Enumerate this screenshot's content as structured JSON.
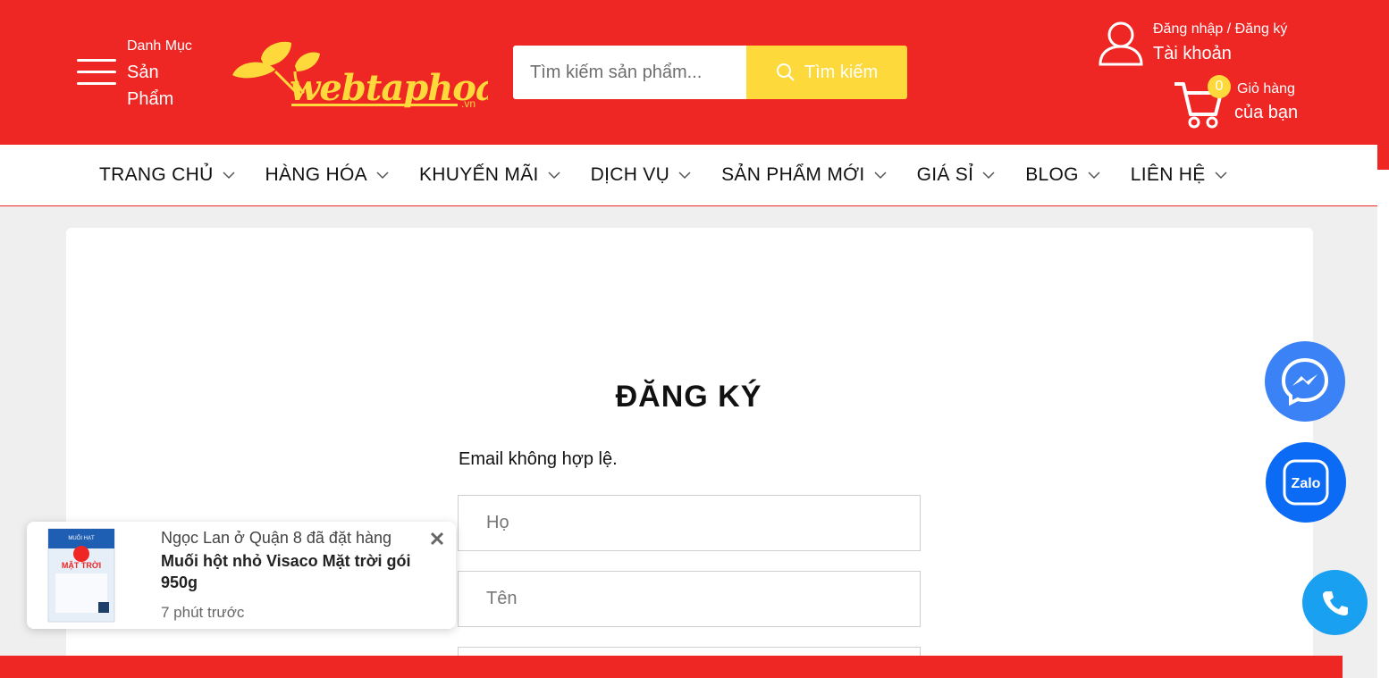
{
  "header": {
    "category_small": "Danh Mục",
    "category_big": "Sản Phẩm",
    "search_placeholder": "Tìm kiếm sản phẩm...",
    "search_button": "Tìm kiếm",
    "account_line1": "Đăng nhập / Đăng ký",
    "account_line2": "Tài khoản",
    "cart_count": "0",
    "cart_line1": "Giỏ hàng",
    "cart_line2": "của bạn",
    "logo_text": "webtaphoa",
    "logo_suffix": ".vn"
  },
  "nav": {
    "items": [
      {
        "label": "TRANG CHỦ"
      },
      {
        "label": "HÀNG HÓA"
      },
      {
        "label": "KHUYẾN MÃI"
      },
      {
        "label": "DỊCH VỤ"
      },
      {
        "label": "SẢN PHẨM MỚI"
      },
      {
        "label": "GIÁ SỈ"
      },
      {
        "label": "BLOG"
      },
      {
        "label": "LIÊN HỆ"
      }
    ]
  },
  "form": {
    "title": "ĐĂNG KÝ",
    "error": "Email không hợp lệ.",
    "last_name_placeholder": "Họ",
    "first_name_placeholder": "Tên"
  },
  "toast": {
    "who": "Ngọc Lan ở Quận 8 đã đặt hàng",
    "product": "Muối hột nhỏ Visaco Mặt trời gói 950g",
    "time": "7 phút trước",
    "thumb_label_top": "MUỐI HẠT",
    "thumb_label_main": "MẶT TRỜI"
  },
  "fab": {
    "zalo_label": "Zalo"
  },
  "colors": {
    "brand_red": "#ee2624",
    "accent_yellow": "#fdd93b"
  }
}
